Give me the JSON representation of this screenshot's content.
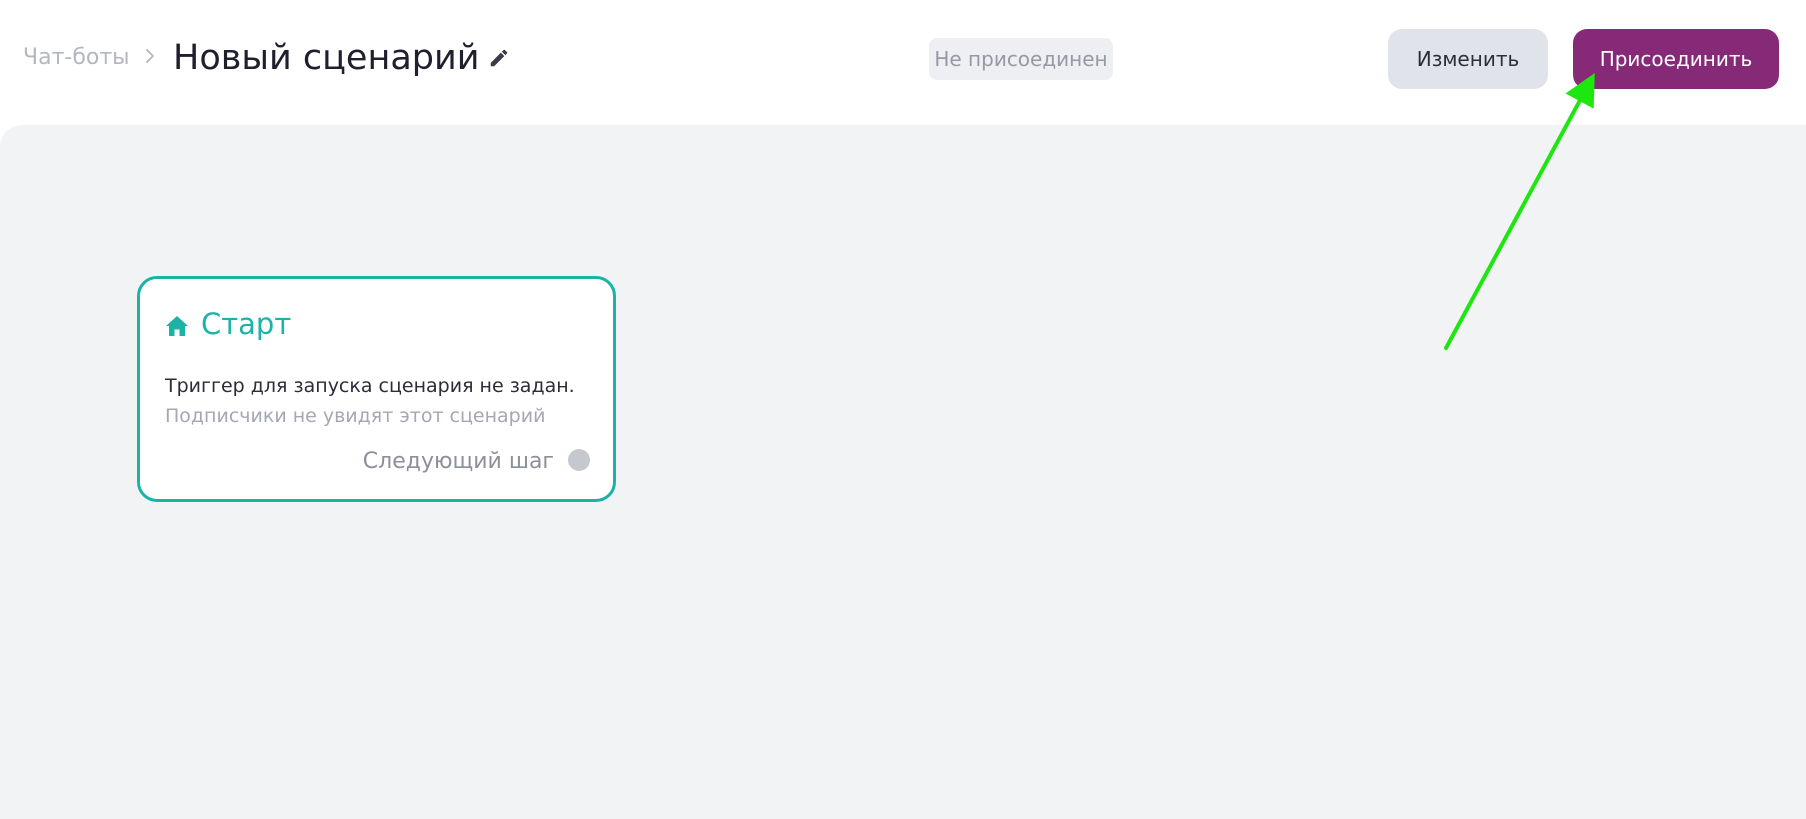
{
  "header": {
    "breadcrumb": "Чат-боты",
    "title": "Новый сценарий",
    "status": "Не присоединен",
    "edit_label": "Изменить",
    "connect_label": "Присоединить"
  },
  "start_card": {
    "title": "Старт",
    "line1": "Триггер для запуска сценария не задан.",
    "line2": "Подписчики не увидят этот сценарий",
    "next_step": "Следующий шаг"
  },
  "colors": {
    "accent": "#862a78",
    "teal": "#1bb3a6",
    "annotation_arrow": "#1ee60f"
  },
  "icons": {
    "breadcrumb_separator": "chevron-right-icon",
    "edit": "pencil-icon",
    "start": "home-icon"
  }
}
